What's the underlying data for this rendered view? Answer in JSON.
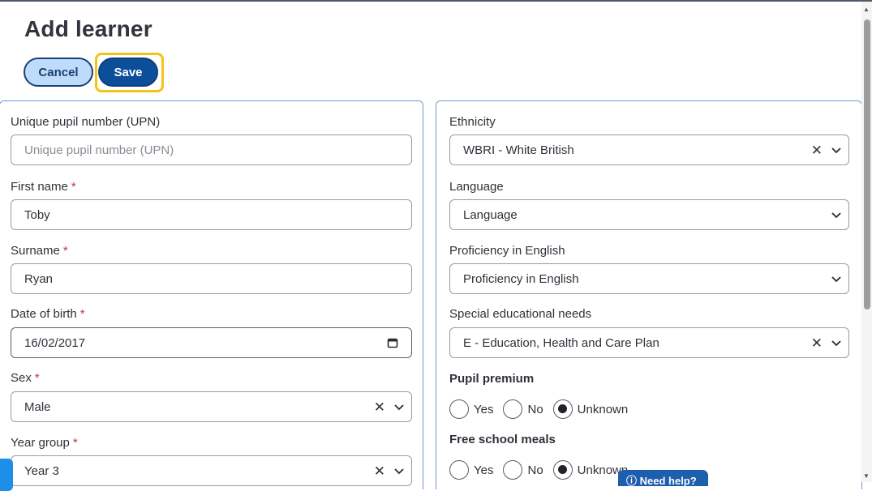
{
  "page": {
    "title": "Add learner"
  },
  "toolbar": {
    "cancel_label": "Cancel",
    "save_label": "Save"
  },
  "left": {
    "upn": {
      "label": "Unique pupil number (UPN)",
      "placeholder": "Unique pupil number (UPN)",
      "value": ""
    },
    "first_name": {
      "label": "First name",
      "required_mark": "*",
      "value": "Toby"
    },
    "surname": {
      "label": "Surname",
      "required_mark": "*",
      "value": "Ryan"
    },
    "dob": {
      "label": "Date of birth",
      "required_mark": "*",
      "value": "16/02/2017"
    },
    "sex": {
      "label": "Sex",
      "required_mark": "*",
      "value": "Male",
      "clear": "✕"
    },
    "year_group": {
      "label": "Year group",
      "required_mark": "*",
      "value": "Year 3",
      "clear": "✕"
    }
  },
  "right": {
    "ethnicity": {
      "label": "Ethnicity",
      "value": "WBRI - White British",
      "clear": "✕"
    },
    "language": {
      "label": "Language",
      "placeholder": "Language"
    },
    "proficiency": {
      "label": "Proficiency in English",
      "placeholder": "Proficiency in English"
    },
    "sen": {
      "label": "Special educational needs",
      "value": "E - Education, Health and Care Plan",
      "clear": "✕"
    },
    "pupil_premium": {
      "label": "Pupil premium",
      "options": [
        "Yes",
        "No",
        "Unknown"
      ],
      "selected": "Unknown"
    },
    "free_school_meals": {
      "label": "Free school meals",
      "options": [
        "Yes",
        "No",
        "Unknown"
      ],
      "selected": "Unknown"
    }
  },
  "help": {
    "label": "Need help?"
  },
  "icons": {
    "clear": "close-icon",
    "dropdown": "chevron-down-icon",
    "date": "calendar-icon"
  },
  "colors": {
    "primary": "#0b4f9a",
    "focus": "#f3c417",
    "required": "#c2343a",
    "panel_border": "#6f98cf"
  }
}
